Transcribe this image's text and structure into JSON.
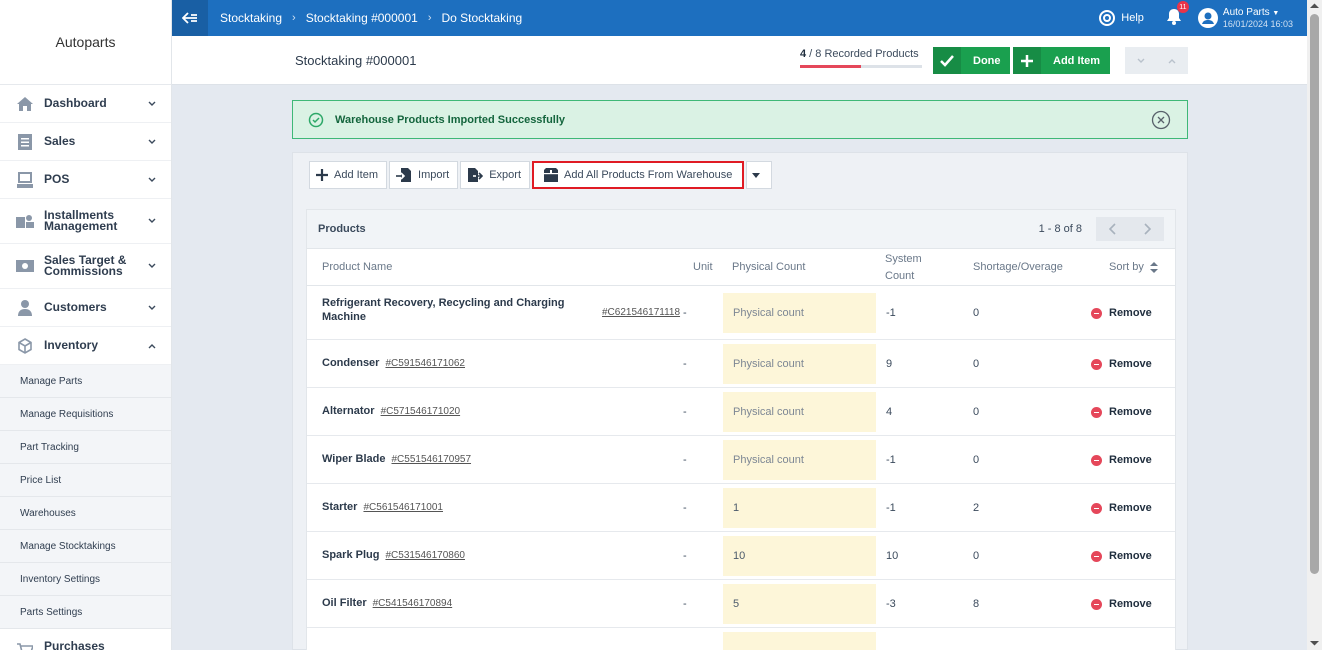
{
  "app": {
    "name": "Autoparts"
  },
  "sidebar": {
    "items": [
      {
        "label": "Dashboard",
        "icon": "home-icon"
      },
      {
        "label": "Sales",
        "icon": "receipt-icon"
      },
      {
        "label": "POS",
        "icon": "pos-icon"
      },
      {
        "label": "Installments Management",
        "icon": "installments-icon"
      },
      {
        "label": "Sales Target & Commissions",
        "icon": "money-icon"
      },
      {
        "label": "Customers",
        "icon": "user-icon"
      },
      {
        "label": "Inventory",
        "icon": "box-icon"
      }
    ],
    "subitems": [
      "Manage Parts",
      "Manage Requisitions",
      "Part Tracking",
      "Price List",
      "Warehouses",
      "Manage Stocktakings",
      "Inventory Settings",
      "Parts Settings"
    ],
    "partial_item": "Purchases"
  },
  "topbar": {
    "crumbs": [
      "Stocktaking",
      "Stocktaking #000001",
      "Do Stocktaking"
    ],
    "help": "Help",
    "notif_count": "11",
    "user_name": "Auto Parts",
    "user_date": "16/01/2024 16:03"
  },
  "header": {
    "title": "Stocktaking #000001",
    "progress_count": "4",
    "progress_rest": " / 8 Recorded Products",
    "progress_fraction": 0.5,
    "done_label": "Done",
    "add_item_label": "Add Item"
  },
  "alert": {
    "message": "Warehouse Products Imported Successfully"
  },
  "toolbar": {
    "add_item": "Add Item",
    "import": "Import",
    "export": "Export",
    "add_all": "Add All Products From Warehouse"
  },
  "products": {
    "title": "Products",
    "range": "1 - 8 of 8",
    "columns": {
      "name": "Product Name",
      "unit": "Unit",
      "physical": "Physical Count",
      "system_line1": "System",
      "system_line2": "Count",
      "shortage": "Shortage/Overage",
      "sort": "Sort by"
    },
    "remove_label": "Remove",
    "rows": [
      {
        "name": "Refrigerant Recovery, Recycling and Charging Machine",
        "code": "#C621546171118",
        "unit": "-",
        "physical": "Physical count",
        "system": "-1",
        "diff": "0"
      },
      {
        "name": "Condenser",
        "code": "#C591546171062",
        "unit": "-",
        "physical": "Physical count",
        "system": "9",
        "diff": "0"
      },
      {
        "name": "Alternator",
        "code": "#C571546171020",
        "unit": "-",
        "physical": "Physical count",
        "system": "4",
        "diff": "0"
      },
      {
        "name": "Wiper Blade",
        "code": "#C551546170957",
        "unit": "-",
        "physical": "Physical count",
        "system": "-1",
        "diff": "0"
      },
      {
        "name": "Starter",
        "code": "#C561546171001",
        "unit": "-",
        "physical": "1",
        "system": "-1",
        "diff": "2"
      },
      {
        "name": "Spark Plug",
        "code": "#C531546170860",
        "unit": "-",
        "physical": "10",
        "system": "10",
        "diff": "0"
      },
      {
        "name": "Oil Filter",
        "code": "#C541546170894",
        "unit": "-",
        "physical": "5",
        "system": "-3",
        "diff": "8"
      }
    ]
  }
}
